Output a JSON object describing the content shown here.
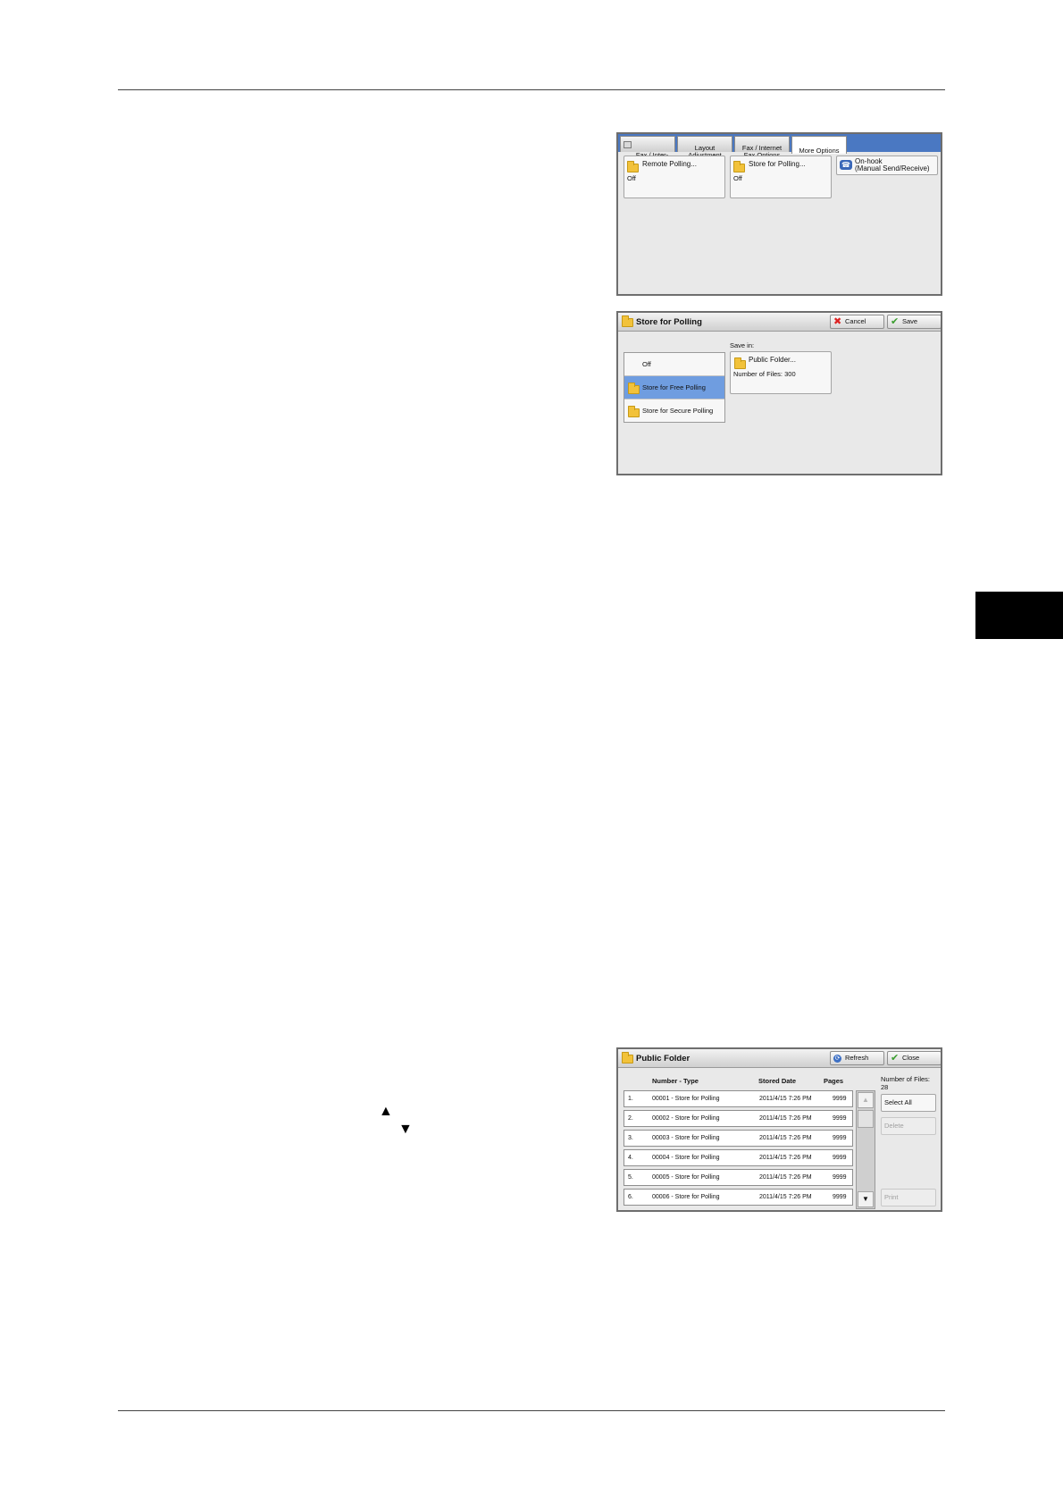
{
  "screen1": {
    "tabs": [
      {
        "label": "Fax / Inter-\nnet Fax"
      },
      {
        "label": "Layout\nAdjustment"
      },
      {
        "label": "Fax / Internet\nFax Options"
      },
      {
        "label": "More Options"
      }
    ],
    "buttons": [
      {
        "label": "Remote Polling...",
        "value": "Off",
        "icon": "folder-icon"
      },
      {
        "label": "Store for Polling...",
        "value": "Off",
        "icon": "folder-icon"
      },
      {
        "label": "On-hook\n(Manual Send/Receive)",
        "icon": "phone-icon"
      }
    ]
  },
  "screen2": {
    "title": "Store for Polling",
    "cancel_label": "Cancel",
    "save_label": "Save",
    "save_in_label": "Save in:",
    "options": [
      "Off",
      "Store for Free Polling",
      "Store for Secure Polling"
    ],
    "selected_option": "Store for Free Polling",
    "folder_button": {
      "label": "Public Folder...",
      "detail": "Number of Files: 300"
    }
  },
  "screen3": {
    "title": "Public Folder",
    "refresh_label": "Refresh",
    "close_label": "Close",
    "columns": [
      "Number - Type",
      "Stored Date",
      "Pages"
    ],
    "number_of_files_label": "Number of Files:",
    "number_of_files": "28",
    "side_buttons": {
      "select_all": "Select All",
      "delete": "Delete",
      "print": "Print"
    },
    "rows": [
      {
        "idx": "1.",
        "name": "00001 - Store for Polling",
        "date": "2011/4/15 7:26 PM",
        "pages": "9999"
      },
      {
        "idx": "2.",
        "name": "00002 - Store for Polling",
        "date": "2011/4/15 7:26 PM",
        "pages": "9999"
      },
      {
        "idx": "3.",
        "name": "00003 - Store for Polling",
        "date": "2011/4/15 7:26 PM",
        "pages": "9999"
      },
      {
        "idx": "4.",
        "name": "00004 - Store for Polling",
        "date": "2011/4/15 7:26 PM",
        "pages": "9999"
      },
      {
        "idx": "5.",
        "name": "00005 - Store for Polling",
        "date": "2011/4/15 7:26 PM",
        "pages": "9999"
      },
      {
        "idx": "6.",
        "name": "00006 - Store for Polling",
        "date": "2011/4/15 7:26 PM",
        "pages": "9999"
      }
    ]
  },
  "arrows": {
    "up": "▲",
    "down": "▼"
  }
}
